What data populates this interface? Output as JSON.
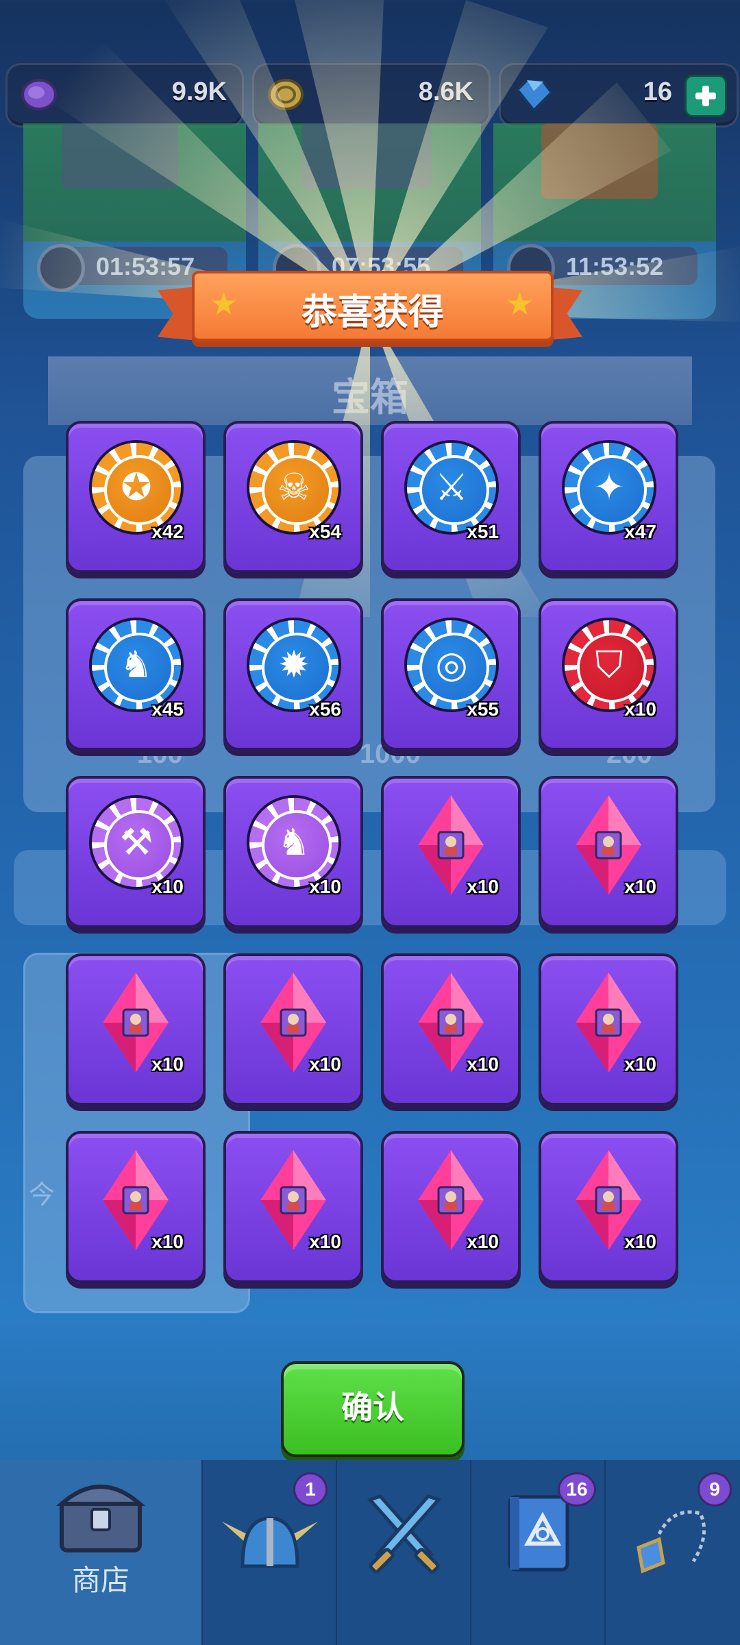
{
  "currency": {
    "purple_coin": {
      "icon": "purple-coin-icon",
      "value": "9.9K"
    },
    "gold_coin": {
      "icon": "gold-coin-icon",
      "value": "8.6K"
    },
    "gem": {
      "icon": "blue-gem-icon",
      "value": "16"
    }
  },
  "background": {
    "chest_timers": [
      "01:53:57",
      "07:53:55",
      "11:53:52"
    ],
    "section_title": "宝箱",
    "faded_prices": [
      "100",
      "1000",
      "200"
    ],
    "faded_label": "今"
  },
  "dialog": {
    "title": "恭喜获得",
    "confirm_label": "确认"
  },
  "rewards": [
    {
      "type": "chip",
      "color": "orange",
      "icon": "winged-emblem-icon",
      "qty": "x42"
    },
    {
      "type": "chip",
      "color": "orange",
      "icon": "skull-icon",
      "qty": "x54"
    },
    {
      "type": "chip",
      "color": "blue",
      "icon": "sword-icon",
      "qty": "x51"
    },
    {
      "type": "chip",
      "color": "blue",
      "icon": "staff-icon",
      "qty": "x47"
    },
    {
      "type": "chip",
      "color": "blue",
      "icon": "dragon-icon",
      "qty": "x45"
    },
    {
      "type": "chip",
      "color": "blue",
      "icon": "eye-burst-icon",
      "qty": "x56"
    },
    {
      "type": "chip",
      "color": "blue",
      "icon": "spiral-icon",
      "qty": "x55"
    },
    {
      "type": "chip",
      "color": "red",
      "icon": "helmet-icon",
      "qty": "x10"
    },
    {
      "type": "chip",
      "color": "purple",
      "icon": "hammer-icon",
      "qty": "x10"
    },
    {
      "type": "chip",
      "color": "purple",
      "icon": "dragon-icon",
      "qty": "x10"
    },
    {
      "type": "gem",
      "icon": "hero-shard-icon",
      "qty": "x10"
    },
    {
      "type": "gem",
      "icon": "hero-shard-icon",
      "qty": "x10"
    },
    {
      "type": "gem",
      "icon": "hero-shard-icon",
      "qty": "x10"
    },
    {
      "type": "gem",
      "icon": "hero-shard-icon",
      "qty": "x10"
    },
    {
      "type": "gem",
      "icon": "hero-shard-icon",
      "qty": "x10"
    },
    {
      "type": "gem",
      "icon": "hero-shard-icon",
      "qty": "x10"
    },
    {
      "type": "gem",
      "icon": "hero-shard-icon",
      "qty": "x10"
    },
    {
      "type": "gem",
      "icon": "hero-shard-icon",
      "qty": "x10"
    },
    {
      "type": "gem",
      "icon": "hero-shard-icon",
      "qty": "x10"
    },
    {
      "type": "gem",
      "icon": "hero-shard-icon",
      "qty": "x10"
    }
  ],
  "nav": {
    "tabs": [
      {
        "icon": "treasure-chest-icon",
        "label": "商店",
        "badge": "",
        "active": true
      },
      {
        "icon": "winged-helmet-icon",
        "label": "",
        "badge": "1",
        "active": false
      },
      {
        "icon": "crossed-swords-icon",
        "label": "",
        "badge": "",
        "active": false
      },
      {
        "icon": "spellbook-icon",
        "label": "",
        "badge": "16",
        "active": false
      },
      {
        "icon": "amulet-icon",
        "label": "",
        "badge": "9",
        "active": false
      }
    ]
  },
  "colors": {
    "tile_purple": "#7a42e4",
    "chip_orange": "#f39a25",
    "chip_blue": "#2a8ae6",
    "chip_red": "#e2283a",
    "chip_purple": "#b56df2",
    "gem_pink": "#ff3f9a",
    "confirm_green": "#4fd233",
    "banner_orange": "#f5853d"
  }
}
